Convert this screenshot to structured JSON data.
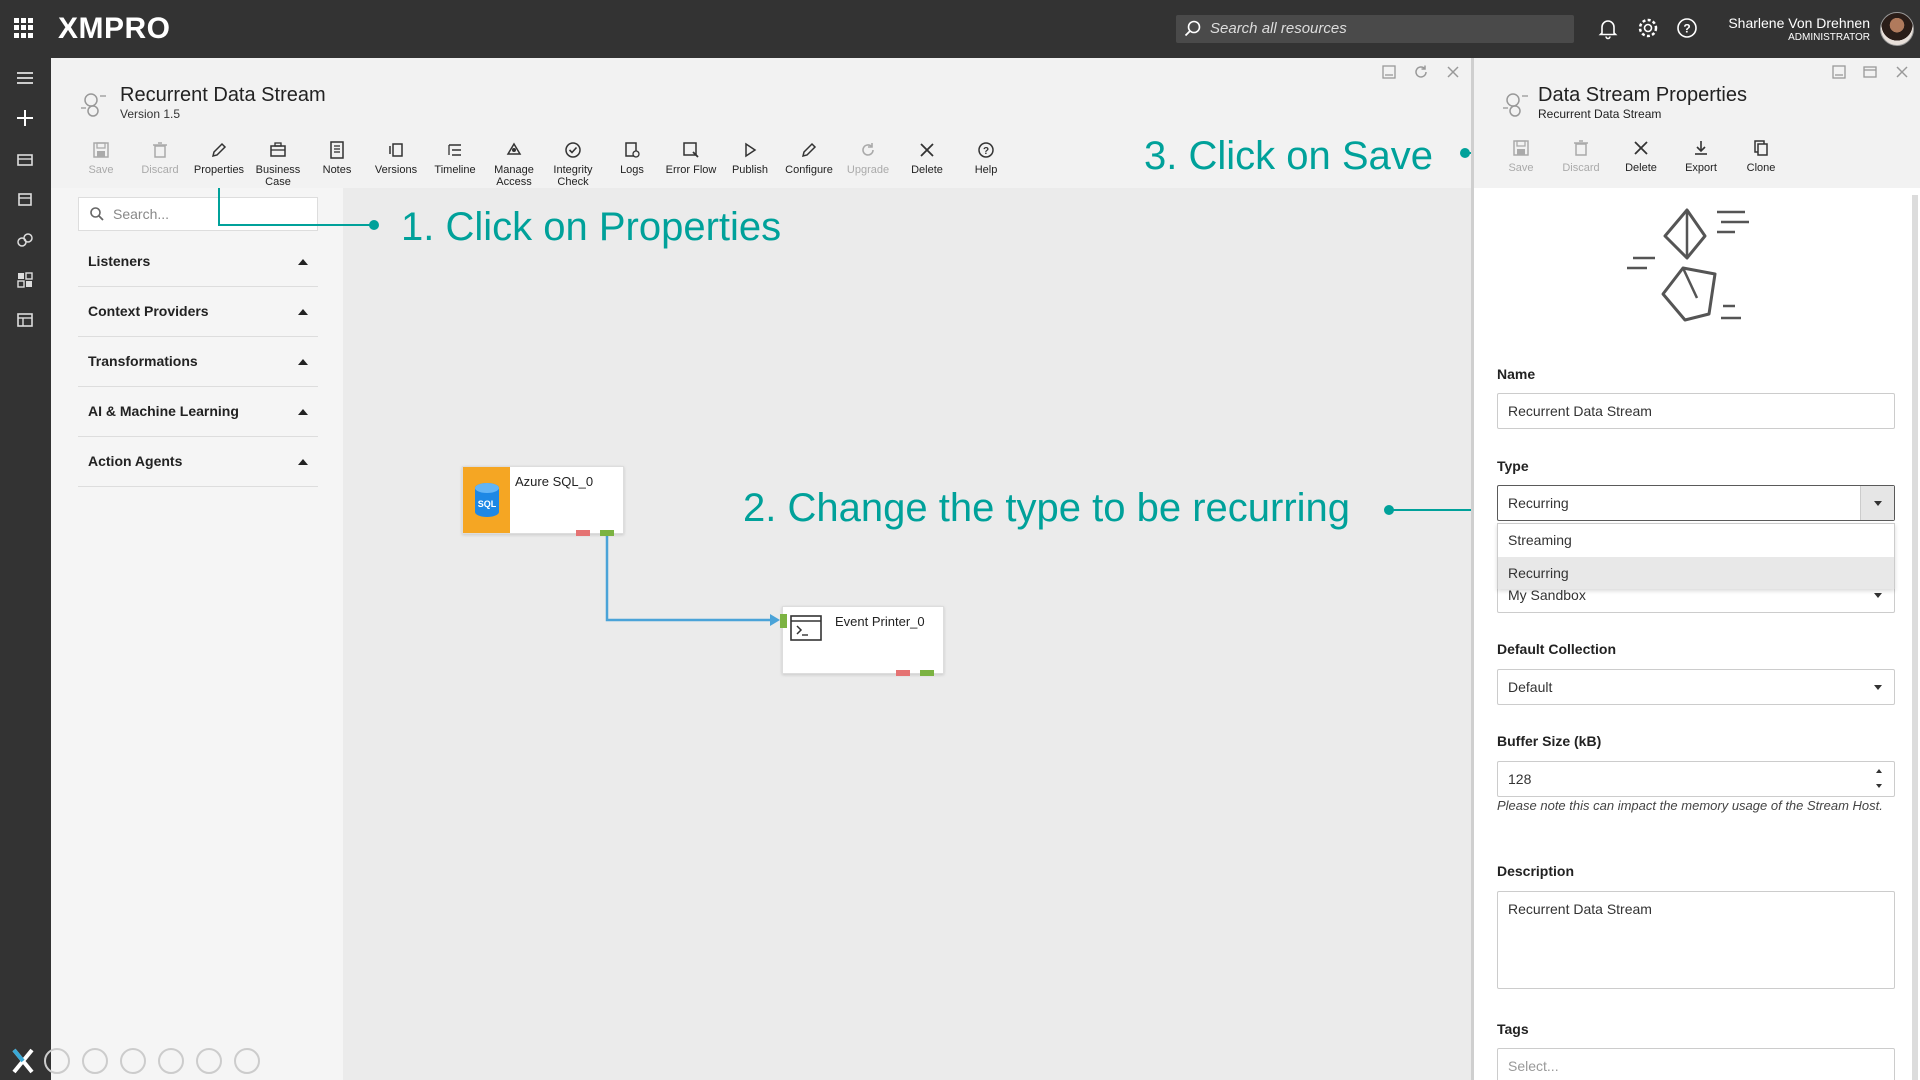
{
  "app": {
    "logo": "XMPRO",
    "search_placeholder": "Search all resources",
    "user_name": "Sharlene Von Drehnen",
    "user_role": "ADMINISTRATOR"
  },
  "main": {
    "title": "Recurrent Data Stream",
    "version": "Version 1.5",
    "toolbar": [
      {
        "label": "Save",
        "icon": "save-icon",
        "disabled": true
      },
      {
        "label": "Discard",
        "icon": "trash-icon",
        "disabled": true
      },
      {
        "label": "Properties",
        "icon": "pencil-icon",
        "disabled": false
      },
      {
        "label": "Business Case",
        "icon": "briefcase-icon",
        "disabled": false
      },
      {
        "label": "Notes",
        "icon": "notes-icon",
        "disabled": false
      },
      {
        "label": "Versions",
        "icon": "versions-icon",
        "disabled": false
      },
      {
        "label": "Timeline",
        "icon": "timeline-icon",
        "disabled": false
      },
      {
        "label": "Manage Access",
        "icon": "access-icon",
        "disabled": false
      },
      {
        "label": "Integrity Check",
        "icon": "check-circle-icon",
        "disabled": false
      },
      {
        "label": "Logs",
        "icon": "logs-icon",
        "disabled": false
      },
      {
        "label": "Error Flow",
        "icon": "error-flow-icon",
        "disabled": false
      },
      {
        "label": "Publish",
        "icon": "play-icon",
        "disabled": false
      },
      {
        "label": "Configure",
        "icon": "pencil-icon",
        "disabled": false
      },
      {
        "label": "Upgrade",
        "icon": "refresh-icon",
        "disabled": true
      },
      {
        "label": "Delete",
        "icon": "close-icon",
        "disabled": false
      },
      {
        "label": "Help",
        "icon": "help-icon",
        "disabled": false
      }
    ],
    "search_placeholder": "Search...",
    "categories": [
      "Listeners",
      "Context Providers",
      "Transformations",
      "AI & Machine Learning",
      "Action Agents"
    ],
    "nodes": [
      {
        "label": "Azure SQL_0",
        "icon": "sql-database-icon"
      },
      {
        "label": "Event Printer_0",
        "icon": "terminal-icon"
      }
    ]
  },
  "annotations": {
    "step1": "1. Click on Properties",
    "step2": "2. Change the type to be recurring",
    "step3": "3. Click on Save"
  },
  "properties": {
    "title": "Data Stream Properties",
    "subtitle": "Recurrent Data Stream",
    "toolbar": [
      {
        "label": "Save",
        "icon": "save-icon",
        "disabled": true
      },
      {
        "label": "Discard",
        "icon": "trash-icon",
        "disabled": true
      },
      {
        "label": "Delete",
        "icon": "close-icon",
        "disabled": false
      },
      {
        "label": "Export",
        "icon": "download-icon",
        "disabled": false
      },
      {
        "label": "Clone",
        "icon": "clone-icon",
        "disabled": false
      }
    ],
    "name_label": "Name",
    "name_value": "Recurrent Data Stream",
    "type_label": "Type",
    "type_value": "Recurring",
    "type_options": [
      "Streaming",
      "Recurring"
    ],
    "collection_value": "My Sandbox",
    "default_collection_label": "Default Collection",
    "default_collection_value": "Default",
    "buffer_label": "Buffer Size (kB)",
    "buffer_value": "128",
    "buffer_note": "Please note this can impact the memory usage of the Stream Host.",
    "description_label": "Description",
    "description_value": "Recurrent Data Stream",
    "tags_label": "Tags",
    "tags_placeholder": "Select..."
  }
}
